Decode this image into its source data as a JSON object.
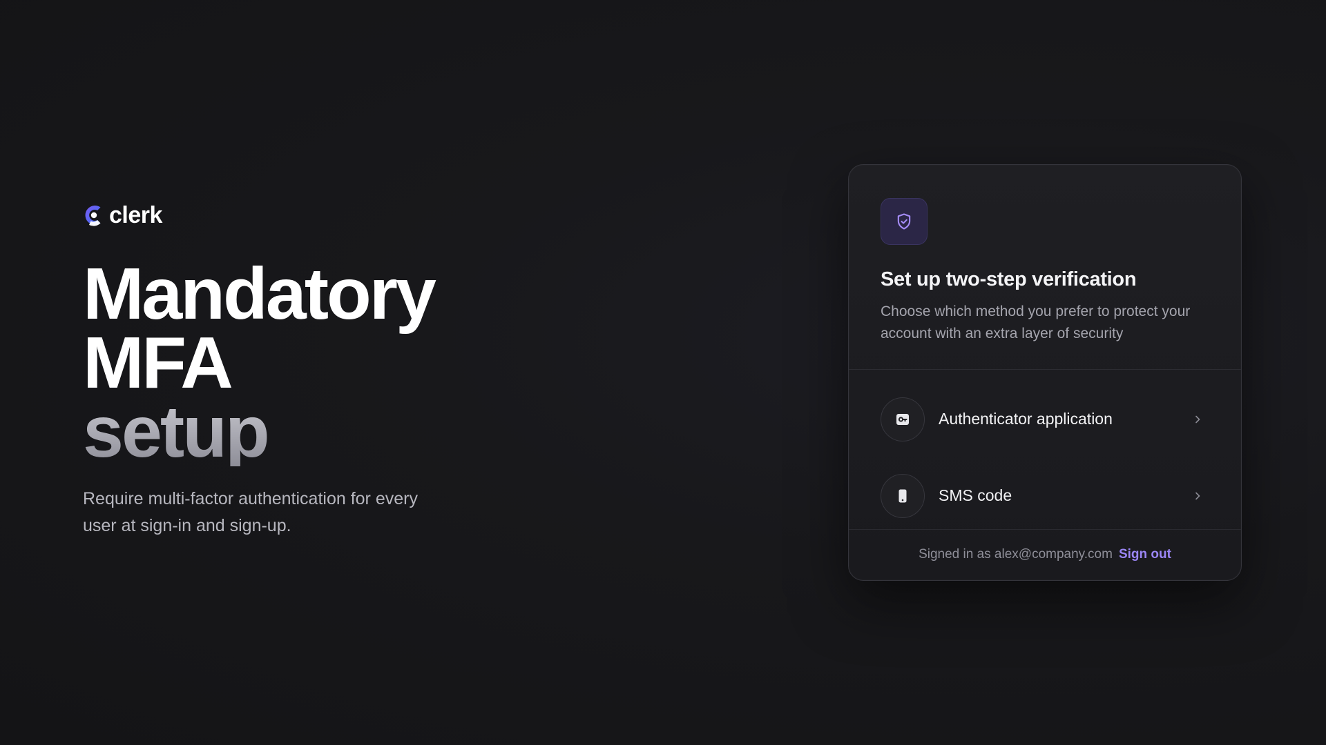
{
  "brand": {
    "name": "clerk",
    "icon": "clerk-logo-icon"
  },
  "hero": {
    "title_line_1": "Mandatory",
    "title_line_2": "MFA",
    "title_line_3": "setup",
    "description": "Require multi-factor authentication for every user at sign-in and sign-up."
  },
  "card": {
    "icon": "shield-check-icon",
    "title": "Set up two-step verification",
    "description": "Choose which method you prefer to protect your account with an extra layer of security",
    "methods": [
      {
        "label": "Authenticator application",
        "icon": "authenticator-key-icon"
      },
      {
        "label": "SMS code",
        "icon": "phone-icon"
      }
    ],
    "footer": {
      "signed_in_text": "Signed in as alex@company.com",
      "sign_out_label": "Sign out"
    }
  },
  "colors": {
    "background": "#18181b",
    "card_background": "#1f1f23",
    "accent": "#9b86f5",
    "shield_tile": "#2b2646"
  }
}
